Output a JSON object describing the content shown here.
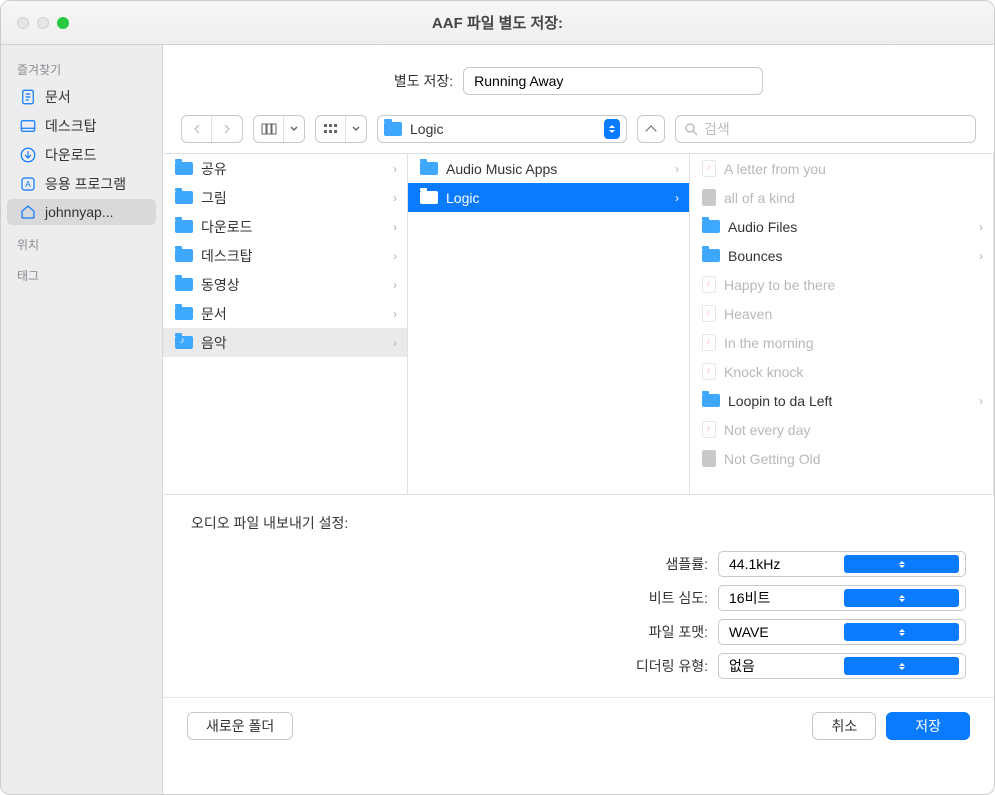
{
  "window": {
    "title": "AAF 파일 별도 저장:"
  },
  "saveas": {
    "label": "별도 저장:",
    "value": "Running Away"
  },
  "path": {
    "label": "Logic"
  },
  "search": {
    "placeholder": "검색"
  },
  "sidebar": {
    "section_favorites": "즐겨찾기",
    "section_locations": "위치",
    "section_tags": "태그",
    "items": [
      {
        "label": "문서",
        "icon": "doc"
      },
      {
        "label": "데스크탑",
        "icon": "desktop"
      },
      {
        "label": "다운로드",
        "icon": "download"
      },
      {
        "label": "응용 프로그램",
        "icon": "apps"
      },
      {
        "label": "johnnyap...",
        "icon": "home",
        "selected": true
      }
    ]
  },
  "browser": {
    "col1": [
      {
        "label": "공유",
        "type": "folder",
        "hasChildren": true
      },
      {
        "label": "그림",
        "type": "folder",
        "hasChildren": true
      },
      {
        "label": "다운로드",
        "type": "folder",
        "hasChildren": true
      },
      {
        "label": "데스크탑",
        "type": "folder",
        "hasChildren": true
      },
      {
        "label": "동영상",
        "type": "folder",
        "hasChildren": true
      },
      {
        "label": "문서",
        "type": "folder",
        "hasChildren": true
      },
      {
        "label": "음악",
        "type": "music-folder",
        "hasChildren": true,
        "selected": "soft"
      }
    ],
    "col2": [
      {
        "label": "Audio Music Apps",
        "type": "folder",
        "hasChildren": true
      },
      {
        "label": "Logic",
        "type": "folder",
        "hasChildren": true,
        "selected": "hard"
      }
    ],
    "col3": [
      {
        "label": "A letter from you",
        "type": "audio",
        "dim": true
      },
      {
        "label": "all of a kind",
        "type": "proj",
        "dim": true
      },
      {
        "label": "Audio Files",
        "type": "folder",
        "hasChildren": true
      },
      {
        "label": "Bounces",
        "type": "folder",
        "hasChildren": true
      },
      {
        "label": "Happy to be there",
        "type": "audio",
        "dim": true
      },
      {
        "label": "Heaven",
        "type": "audio",
        "dim": true
      },
      {
        "label": "In the morning",
        "type": "audio",
        "dim": true
      },
      {
        "label": "Knock knock",
        "type": "audio",
        "dim": true
      },
      {
        "label": "Loopin to da Left",
        "type": "folder",
        "hasChildren": true
      },
      {
        "label": "Not every day",
        "type": "audio",
        "dim": true
      },
      {
        "label": "Not Getting Old",
        "type": "proj",
        "dim": true
      }
    ]
  },
  "settings": {
    "title": "오디오 파일 내보내기 설정:",
    "rows": [
      {
        "label": "샘플률:",
        "value": "44.1kHz"
      },
      {
        "label": "비트 심도:",
        "value": "16비트"
      },
      {
        "label": "파일 포맷:",
        "value": "WAVE"
      },
      {
        "label": "디더링 유형:",
        "value": "없음"
      }
    ]
  },
  "footer": {
    "new_folder": "새로운 폴더",
    "cancel": "취소",
    "save": "저장"
  }
}
